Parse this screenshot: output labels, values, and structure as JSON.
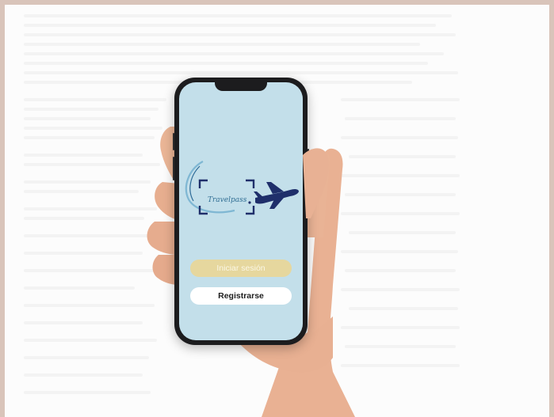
{
  "app": {
    "logo_text": "Travelpass",
    "login_label": "Iniciar sesión",
    "register_label": "Registrarse"
  },
  "colors": {
    "screen_background": "#c3dfea",
    "login_button": "#e6d79e",
    "register_button": "#ffffff",
    "logo_accent": "#1f2f6b"
  },
  "icons": [
    "airplane-icon",
    "scan-frame-icon",
    "swoosh-icon"
  ]
}
